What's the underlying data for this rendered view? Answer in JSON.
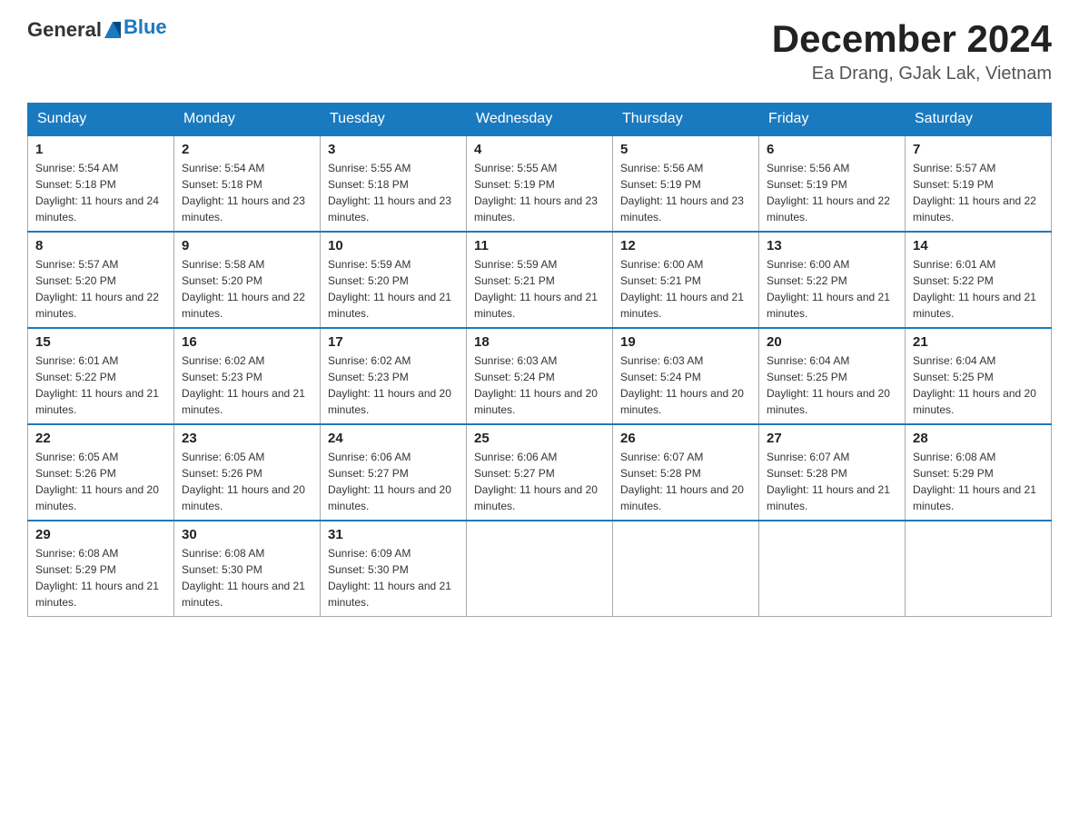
{
  "header": {
    "logo_general": "General",
    "logo_blue": "Blue",
    "title": "December 2024",
    "location": "Ea Drang, GJak Lak, Vietnam"
  },
  "calendar": {
    "days_of_week": [
      "Sunday",
      "Monday",
      "Tuesday",
      "Wednesday",
      "Thursday",
      "Friday",
      "Saturday"
    ],
    "weeks": [
      [
        {
          "day": "1",
          "sunrise": "Sunrise: 5:54 AM",
          "sunset": "Sunset: 5:18 PM",
          "daylight": "Daylight: 11 hours and 24 minutes."
        },
        {
          "day": "2",
          "sunrise": "Sunrise: 5:54 AM",
          "sunset": "Sunset: 5:18 PM",
          "daylight": "Daylight: 11 hours and 23 minutes."
        },
        {
          "day": "3",
          "sunrise": "Sunrise: 5:55 AM",
          "sunset": "Sunset: 5:18 PM",
          "daylight": "Daylight: 11 hours and 23 minutes."
        },
        {
          "day": "4",
          "sunrise": "Sunrise: 5:55 AM",
          "sunset": "Sunset: 5:19 PM",
          "daylight": "Daylight: 11 hours and 23 minutes."
        },
        {
          "day": "5",
          "sunrise": "Sunrise: 5:56 AM",
          "sunset": "Sunset: 5:19 PM",
          "daylight": "Daylight: 11 hours and 23 minutes."
        },
        {
          "day": "6",
          "sunrise": "Sunrise: 5:56 AM",
          "sunset": "Sunset: 5:19 PM",
          "daylight": "Daylight: 11 hours and 22 minutes."
        },
        {
          "day": "7",
          "sunrise": "Sunrise: 5:57 AM",
          "sunset": "Sunset: 5:19 PM",
          "daylight": "Daylight: 11 hours and 22 minutes."
        }
      ],
      [
        {
          "day": "8",
          "sunrise": "Sunrise: 5:57 AM",
          "sunset": "Sunset: 5:20 PM",
          "daylight": "Daylight: 11 hours and 22 minutes."
        },
        {
          "day": "9",
          "sunrise": "Sunrise: 5:58 AM",
          "sunset": "Sunset: 5:20 PM",
          "daylight": "Daylight: 11 hours and 22 minutes."
        },
        {
          "day": "10",
          "sunrise": "Sunrise: 5:59 AM",
          "sunset": "Sunset: 5:20 PM",
          "daylight": "Daylight: 11 hours and 21 minutes."
        },
        {
          "day": "11",
          "sunrise": "Sunrise: 5:59 AM",
          "sunset": "Sunset: 5:21 PM",
          "daylight": "Daylight: 11 hours and 21 minutes."
        },
        {
          "day": "12",
          "sunrise": "Sunrise: 6:00 AM",
          "sunset": "Sunset: 5:21 PM",
          "daylight": "Daylight: 11 hours and 21 minutes."
        },
        {
          "day": "13",
          "sunrise": "Sunrise: 6:00 AM",
          "sunset": "Sunset: 5:22 PM",
          "daylight": "Daylight: 11 hours and 21 minutes."
        },
        {
          "day": "14",
          "sunrise": "Sunrise: 6:01 AM",
          "sunset": "Sunset: 5:22 PM",
          "daylight": "Daylight: 11 hours and 21 minutes."
        }
      ],
      [
        {
          "day": "15",
          "sunrise": "Sunrise: 6:01 AM",
          "sunset": "Sunset: 5:22 PM",
          "daylight": "Daylight: 11 hours and 21 minutes."
        },
        {
          "day": "16",
          "sunrise": "Sunrise: 6:02 AM",
          "sunset": "Sunset: 5:23 PM",
          "daylight": "Daylight: 11 hours and 21 minutes."
        },
        {
          "day": "17",
          "sunrise": "Sunrise: 6:02 AM",
          "sunset": "Sunset: 5:23 PM",
          "daylight": "Daylight: 11 hours and 20 minutes."
        },
        {
          "day": "18",
          "sunrise": "Sunrise: 6:03 AM",
          "sunset": "Sunset: 5:24 PM",
          "daylight": "Daylight: 11 hours and 20 minutes."
        },
        {
          "day": "19",
          "sunrise": "Sunrise: 6:03 AM",
          "sunset": "Sunset: 5:24 PM",
          "daylight": "Daylight: 11 hours and 20 minutes."
        },
        {
          "day": "20",
          "sunrise": "Sunrise: 6:04 AM",
          "sunset": "Sunset: 5:25 PM",
          "daylight": "Daylight: 11 hours and 20 minutes."
        },
        {
          "day": "21",
          "sunrise": "Sunrise: 6:04 AM",
          "sunset": "Sunset: 5:25 PM",
          "daylight": "Daylight: 11 hours and 20 minutes."
        }
      ],
      [
        {
          "day": "22",
          "sunrise": "Sunrise: 6:05 AM",
          "sunset": "Sunset: 5:26 PM",
          "daylight": "Daylight: 11 hours and 20 minutes."
        },
        {
          "day": "23",
          "sunrise": "Sunrise: 6:05 AM",
          "sunset": "Sunset: 5:26 PM",
          "daylight": "Daylight: 11 hours and 20 minutes."
        },
        {
          "day": "24",
          "sunrise": "Sunrise: 6:06 AM",
          "sunset": "Sunset: 5:27 PM",
          "daylight": "Daylight: 11 hours and 20 minutes."
        },
        {
          "day": "25",
          "sunrise": "Sunrise: 6:06 AM",
          "sunset": "Sunset: 5:27 PM",
          "daylight": "Daylight: 11 hours and 20 minutes."
        },
        {
          "day": "26",
          "sunrise": "Sunrise: 6:07 AM",
          "sunset": "Sunset: 5:28 PM",
          "daylight": "Daylight: 11 hours and 20 minutes."
        },
        {
          "day": "27",
          "sunrise": "Sunrise: 6:07 AM",
          "sunset": "Sunset: 5:28 PM",
          "daylight": "Daylight: 11 hours and 21 minutes."
        },
        {
          "day": "28",
          "sunrise": "Sunrise: 6:08 AM",
          "sunset": "Sunset: 5:29 PM",
          "daylight": "Daylight: 11 hours and 21 minutes."
        }
      ],
      [
        {
          "day": "29",
          "sunrise": "Sunrise: 6:08 AM",
          "sunset": "Sunset: 5:29 PM",
          "daylight": "Daylight: 11 hours and 21 minutes."
        },
        {
          "day": "30",
          "sunrise": "Sunrise: 6:08 AM",
          "sunset": "Sunset: 5:30 PM",
          "daylight": "Daylight: 11 hours and 21 minutes."
        },
        {
          "day": "31",
          "sunrise": "Sunrise: 6:09 AM",
          "sunset": "Sunset: 5:30 PM",
          "daylight": "Daylight: 11 hours and 21 minutes."
        },
        null,
        null,
        null,
        null
      ]
    ]
  }
}
